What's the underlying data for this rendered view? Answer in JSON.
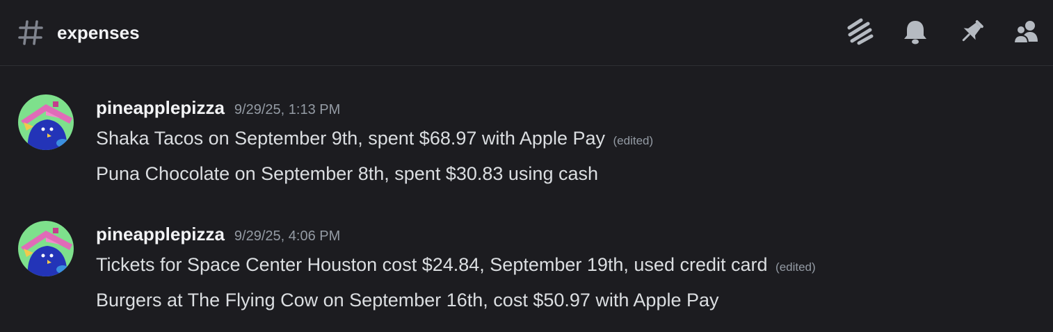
{
  "channel": {
    "name": "expenses",
    "icon": "hash-icon"
  },
  "toolbar": {
    "icons": [
      "threads-icon",
      "bell-icon",
      "pin-icon",
      "members-icon"
    ]
  },
  "messages": [
    {
      "username": "pineapplepizza",
      "timestamp": "9/29/25, 1:13 PM",
      "lines": [
        {
          "text": "Shaka Tacos on September 9th, spent $68.97 with Apple Pay",
          "edited": "(edited)"
        },
        {
          "text": "Puna Chocolate on September 8th, spent $30.83 using cash",
          "edited": ""
        }
      ]
    },
    {
      "username": "pineapplepizza",
      "timestamp": "9/29/25, 4:06 PM",
      "lines": [
        {
          "text": "Tickets for Space Center Houston cost $24.84, September 19th, used credit card",
          "edited": "(edited)"
        },
        {
          "text": "Burgers at The Flying Cow on September 16th, cost $50.97 with Apple Pay",
          "edited": ""
        }
      ]
    }
  ],
  "colors": {
    "background": "#1c1c20",
    "text": "#dbdee1",
    "muted": "#949ba4",
    "avatar_bg": "#7ee08c"
  }
}
